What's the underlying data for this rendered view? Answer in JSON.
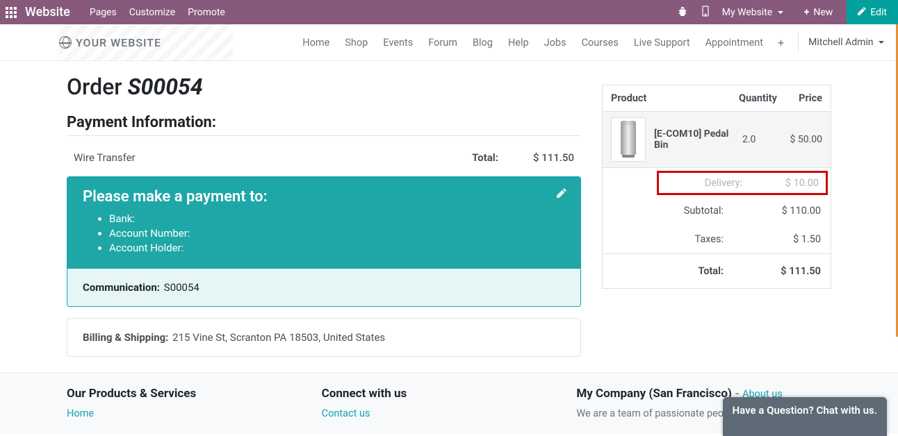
{
  "topbar": {
    "brand": "Website",
    "menu": [
      "Pages",
      "Customize",
      "Promote"
    ],
    "my_site": "My Website",
    "new": "New",
    "edit": "Edit"
  },
  "nav": {
    "logo": "YOUR WEBSITE",
    "links": [
      "Home",
      "Shop",
      "Events",
      "Forum",
      "Blog",
      "Help",
      "Jobs",
      "Courses",
      "Live Support",
      "Appointment"
    ],
    "user": "Mitchell Admin"
  },
  "order": {
    "title_prefix": "Order ",
    "number": "S00054",
    "payment_heading": "Payment Information:",
    "method": "Wire Transfer",
    "total_label": "Total:",
    "total_value": "$ 111.50",
    "make_payment": "Please make a payment to:",
    "bank_label": "Bank:",
    "account_number_label": "Account Number:",
    "account_holder_label": "Account Holder:",
    "communication_label": "Communication:",
    "communication_value": "S00054",
    "billship_label": "Billing & Shipping:",
    "billship_value": "215 Vine St, Scranton PA 18503, United States"
  },
  "summary": {
    "h_product": "Product",
    "h_qty": "Quantity",
    "h_price": "Price",
    "product_name": "[E-COM10] Pedal Bin",
    "product_qty": "2.0",
    "product_price": "$ 50.00",
    "delivery_label": "Delivery:",
    "delivery_value": "$ 10.00",
    "subtotal_label": "Subtotal:",
    "subtotal_value": "$ 110.00",
    "taxes_label": "Taxes:",
    "taxes_value": "$ 1.50",
    "total_label": "Total:",
    "total_value": "$ 111.50"
  },
  "footer": {
    "col1_title": "Our Products & Services",
    "col1_link": "Home",
    "col2_title": "Connect with us",
    "col2_link": "Contact us",
    "col3_title": "My Company (San Francisco)",
    "col3_dash": " - ",
    "col3_about": "About us",
    "col3_text": "We are a team of passionate people whose goal is to"
  },
  "chat": "Have a Question? Chat with us."
}
